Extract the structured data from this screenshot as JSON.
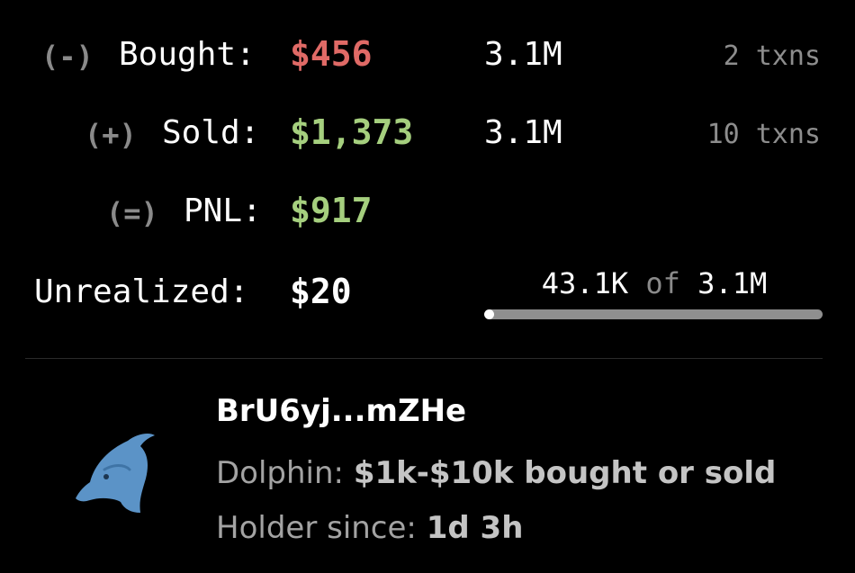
{
  "bought": {
    "sign": "(-)",
    "label": "Bought:",
    "value": "$456",
    "amount": "3.1M",
    "txns": "2 txns"
  },
  "sold": {
    "sign": "(+)",
    "label": "Sold:",
    "value": "$1,373",
    "amount": "3.1M",
    "txns": "10 txns"
  },
  "pnl": {
    "sign": "(=)",
    "label": "PNL:",
    "value": "$917"
  },
  "unrealized": {
    "label": "Unrealized:",
    "value": "$20",
    "held": "43.1K",
    "of": "of",
    "total": "3.1M",
    "fraction": 0.014
  },
  "holder": {
    "wallet": "BrU6yj...mZHe",
    "tier_label": "Dolphin:",
    "tier_desc": "$1k-$10k bought or sold",
    "since_label": "Holder since:",
    "since_value": "1d 3h",
    "icon": "dolphin-icon"
  },
  "colors": {
    "negative": "#e06a66",
    "positive": "#a5cf7e",
    "dolphin": "#5b93c7"
  }
}
